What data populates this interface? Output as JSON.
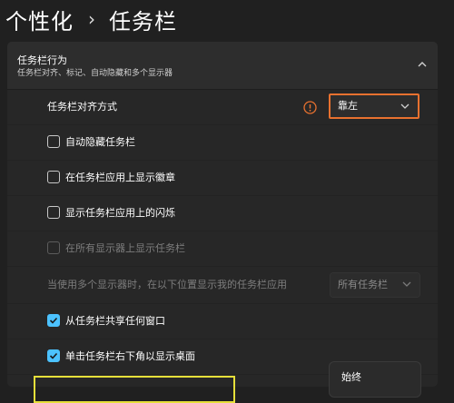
{
  "breadcrumb": {
    "parent": "个性化",
    "separator": "›",
    "current": "任务栏"
  },
  "section": {
    "title": "任务栏行为",
    "subtitle": "任务栏对齐、标记、自动隐藏和多个显示器"
  },
  "alignment": {
    "label": "任务栏对齐方式",
    "value": "靠左",
    "warning_icon": "warning-circle-icon"
  },
  "options": [
    {
      "label": "自动隐藏任务栏",
      "checked": false,
      "disabled": false
    },
    {
      "label": "在任务栏应用上显示徽章",
      "checked": false,
      "disabled": false
    },
    {
      "label": "显示任务栏应用上的闪烁",
      "checked": false,
      "disabled": false
    },
    {
      "label": "在所有显示器上显示任务栏",
      "checked": false,
      "disabled": true
    }
  ],
  "multi_display": {
    "label": "当使用多个显示器时，在以下位置显示我的任务栏应用",
    "value": "所有任务栏"
  },
  "options2": [
    {
      "label": "从任务栏共享任何窗口",
      "checked": true
    },
    {
      "label": "单击任务栏右下角以显示桌面",
      "checked": true
    }
  ],
  "popup_menu": {
    "item": "始终"
  },
  "colors": {
    "accent": "#4cc2ff",
    "highlight_orange": "#e8712f",
    "highlight_yellow": "#e6df3a",
    "background": "#202020"
  }
}
